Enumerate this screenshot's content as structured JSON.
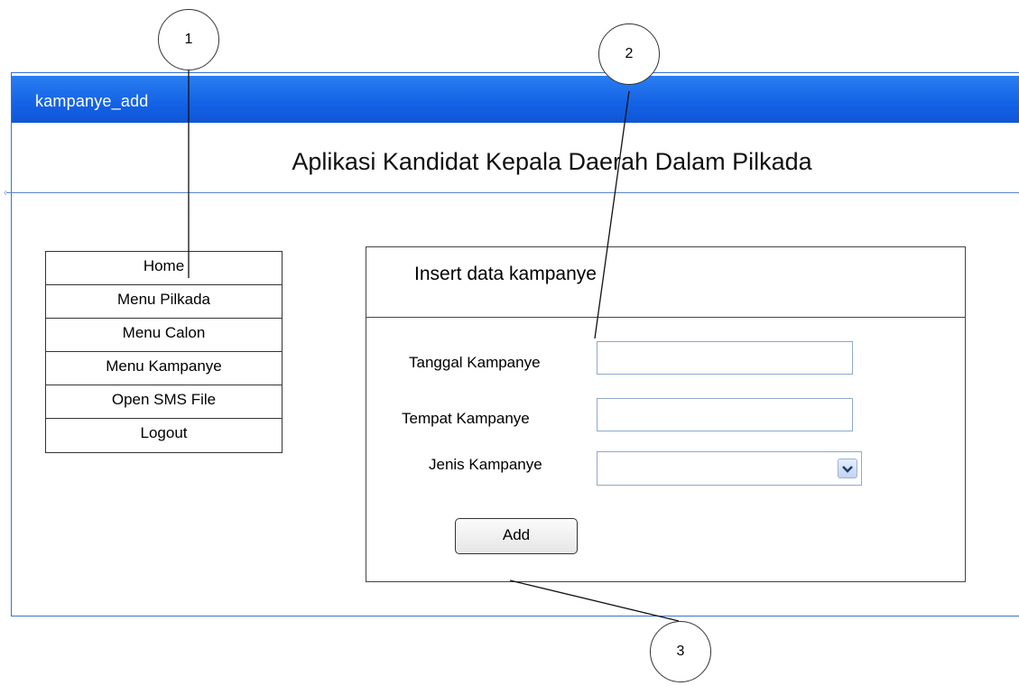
{
  "window": {
    "title": "kampanye_add"
  },
  "app": {
    "title": "Aplikasi Kandidat Kepala Daerah Dalam Pilkada"
  },
  "menu": {
    "items": [
      {
        "label": "Home"
      },
      {
        "label": "Menu Pilkada"
      },
      {
        "label": "Menu Calon"
      },
      {
        "label": "Menu Kampanye"
      },
      {
        "label": "Open SMS File"
      },
      {
        "label": "Logout"
      }
    ]
  },
  "form": {
    "title": "Insert data kampanye",
    "tanggal_label": "Tanggal Kampanye",
    "tanggal_value": "",
    "tempat_label": "Tempat Kampanye",
    "tempat_value": "",
    "jenis_label": "Jenis Kampanye",
    "jenis_value": "",
    "add_label": "Add"
  },
  "callouts": [
    "1",
    "2",
    "3"
  ],
  "colors": {
    "titlebar": "#1462e6",
    "border": "#3a6fd8"
  },
  "icons": {
    "dropdown": "chevron-down-icon"
  }
}
